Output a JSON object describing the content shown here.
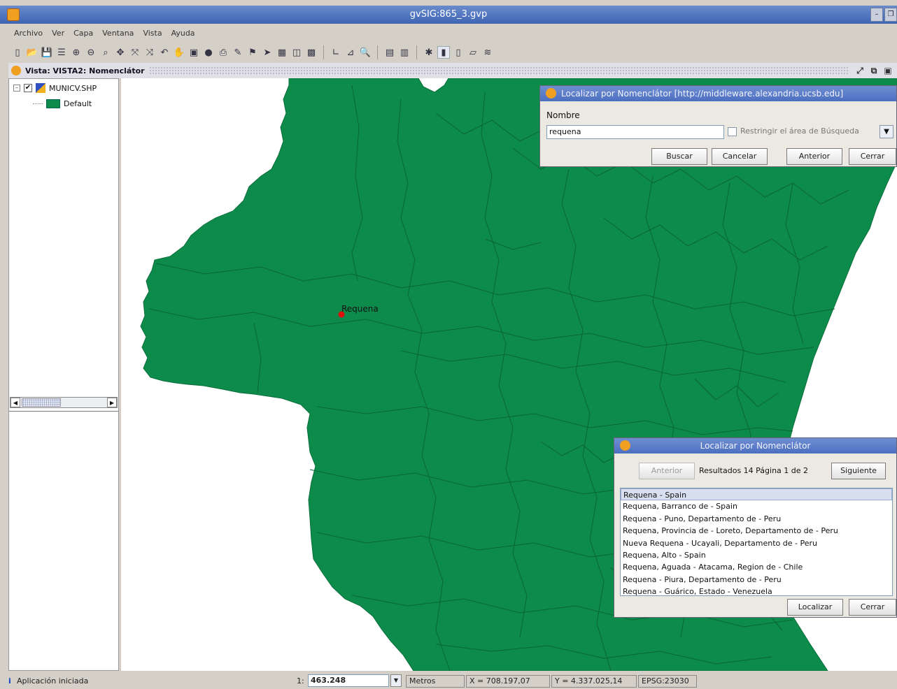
{
  "window": {
    "title": "gvSIG:865_3.gvp"
  },
  "menu": [
    "Archivo",
    "Ver",
    "Capa",
    "Ventana",
    "Vista",
    "Ayuda"
  ],
  "toolbar": {
    "icons": [
      "new-file-icon",
      "open-icon",
      "save-icon",
      "layer-icon",
      "zoom-in-icon",
      "zoom-minus-icon",
      "zoom-select-icon",
      "full-extent-icon",
      "zoom-icon",
      "zoom-icon",
      "previous-zoom-icon",
      "pan-icon",
      "frame-icon",
      "gear-icon",
      "print-icon",
      "pencil-icon",
      "flag-icon",
      "pointer-icon",
      "select-icon",
      "select-icon",
      "table-icon",
      "line-icon",
      "measure-icon",
      "search-icon",
      "list-icon",
      "graph-icon",
      "wand-icon",
      "doc-icon",
      "doc-icon",
      "eraser-icon",
      "layers-icon"
    ]
  },
  "view": {
    "title": "Vista: VISTA2: Nomenclátor"
  },
  "toc": {
    "layer_name": "MUNICV.SHP",
    "legend_label": "Default",
    "legend_color": "#0d8b4b"
  },
  "map": {
    "fill_color": "#0d8b4b",
    "marker_label": "Requena",
    "marker_color": "#e01010"
  },
  "search_dialog": {
    "title": "Localizar por Nomenclátor [http://middleware.alexandria.ucsb.edu]",
    "name_label": "Nombre",
    "name_value": "requena",
    "restrict_label": "Restringir el área de Búsqueda",
    "buttons": {
      "search": "Buscar",
      "cancel": "Cancelar",
      "previous": "Anterior",
      "close": "Cerrar"
    }
  },
  "results_dialog": {
    "title": "Localizar por Nomenclátor",
    "prev_button": "Anterior",
    "summary": "Resultados 14 Página 1 de 2",
    "next_button": "Siguiente",
    "results": [
      "Requena - Spain",
      "Requena, Barranco de - Spain",
      "Requena - Puno, Departamento de - Peru",
      "Requena, Provincia de - Loreto, Departamento de - Peru",
      "Nueva Requena - Ucayali, Departamento de - Peru",
      "Requena, Alto - Spain",
      "Requena, Aguada - Atacama, Region de - Chile",
      "Requena - Piura, Departamento de - Peru",
      "Requena - Guárico, Estado - Venezuela"
    ],
    "locate_button": "Localizar",
    "close_button": "Cerrar"
  },
  "statusbar": {
    "message": "Aplicación iniciada",
    "scale_prefix": "1:",
    "scale": "463.248",
    "units": "Metros",
    "x": "X = 708.197,07",
    "y": "Y = 4.337.025,14",
    "crs": "EPSG:23030"
  }
}
